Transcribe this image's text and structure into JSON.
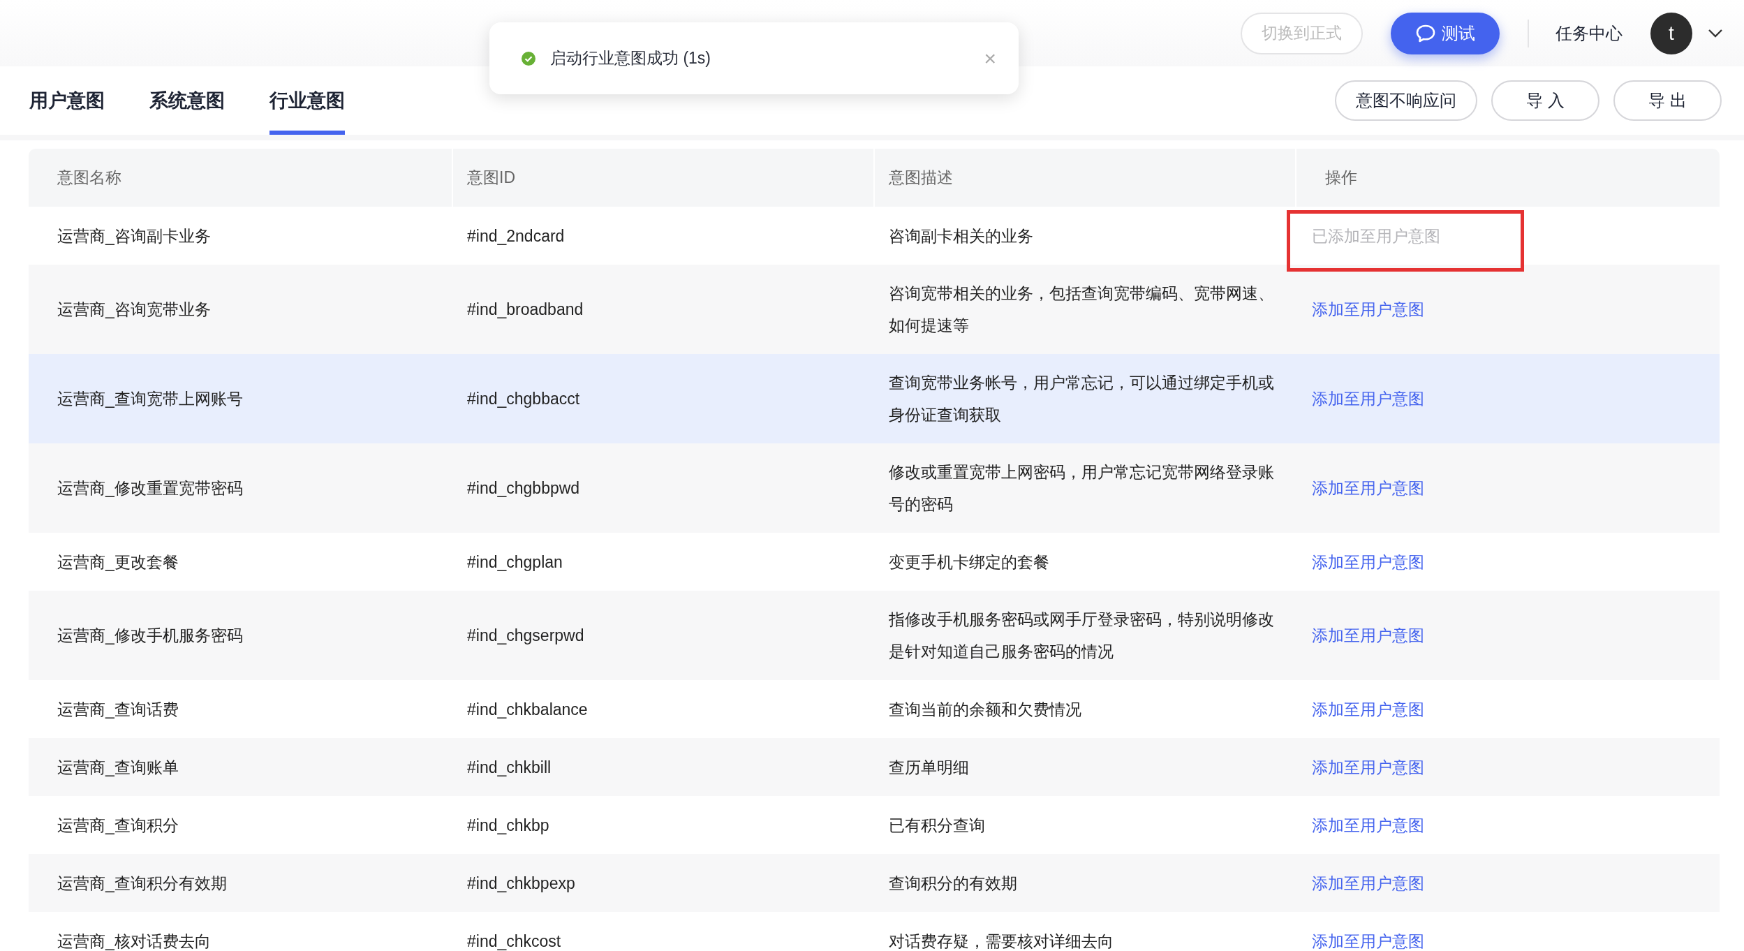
{
  "toast": {
    "message": "启动行业意图成功 (1s)",
    "close": "×"
  },
  "header": {
    "switch_button": {
      "label": "切换到正式",
      "disabled": true
    },
    "test_button": {
      "label": "测试"
    },
    "task_center": "任务中心",
    "avatar": "t"
  },
  "tabs": [
    {
      "label": "用户意图",
      "selected": false
    },
    {
      "label": "系统意图",
      "selected": false
    },
    {
      "label": "行业意图",
      "selected": true
    }
  ],
  "toolbar": [
    "意图不响应问",
    "导 入",
    "导 出"
  ],
  "table": {
    "columns": [
      "意图名称",
      "意图ID",
      "意图描述",
      "操作"
    ],
    "rows": [
      {
        "name": "运营商_咨询副卡业务",
        "id": "#ind_2ndcard",
        "description": "咨询副卡相关的业务",
        "action": "已添加至用户意图",
        "added": true,
        "boxed": true,
        "hovered": false
      },
      {
        "name": "运营商_咨询宽带业务",
        "id": "#ind_broadband",
        "description": "咨询宽带相关的业务，包括查询宽带编码、宽带网速、如何提速等",
        "action": "添加至用户意图",
        "added": false,
        "boxed": false,
        "hovered": false
      },
      {
        "name": "运营商_查询宽带上网账号",
        "id": "#ind_chgbbacct",
        "description": "查询宽带业务帐号，用户常忘记，可以通过绑定手机或身份证查询获取",
        "action": "添加至用户意图",
        "added": false,
        "boxed": false,
        "hovered": true
      },
      {
        "name": "运营商_修改重置宽带密码",
        "id": "#ind_chgbbpwd",
        "description": "修改或重置宽带上网密码，用户常忘记宽带网络登录账号的密码",
        "action": "添加至用户意图",
        "added": false,
        "boxed": false,
        "hovered": false
      },
      {
        "name": "运营商_更改套餐",
        "id": "#ind_chgplan",
        "description": "变更手机卡绑定的套餐",
        "action": "添加至用户意图",
        "added": false,
        "boxed": false,
        "hovered": false
      },
      {
        "name": "运营商_修改手机服务密码",
        "id": "#ind_chgserpwd",
        "description": "指修改手机服务密码或网手厅登录密码，特别说明修改是针对知道自己服务密码的情况",
        "action": "添加至用户意图",
        "added": false,
        "boxed": false,
        "hovered": false
      },
      {
        "name": "运营商_查询话费",
        "id": "#ind_chkbalance",
        "description": "查询当前的余额和欠费情况",
        "action": "添加至用户意图",
        "added": false,
        "boxed": false,
        "hovered": false
      },
      {
        "name": "运营商_查询账单",
        "id": "#ind_chkbill",
        "description": "查历单明细",
        "action": "添加至用户意图",
        "added": false,
        "boxed": false,
        "hovered": false
      },
      {
        "name": "运营商_查询积分",
        "id": "#ind_chkbp",
        "description": "已有积分查询",
        "action": "添加至用户意图",
        "added": false,
        "boxed": false,
        "hovered": false
      },
      {
        "name": "运营商_查询积分有效期",
        "id": "#ind_chkbpexp",
        "description": "查询积分的有效期",
        "action": "添加至用户意图",
        "added": false,
        "boxed": false,
        "hovered": false
      },
      {
        "name": "运营商_核对话费去向",
        "id": "#ind_chkcost",
        "description": "对话费存疑，需要核对详细去向",
        "action": "添加至用户意图",
        "added": false,
        "boxed": false,
        "hovered": false
      }
    ]
  }
}
